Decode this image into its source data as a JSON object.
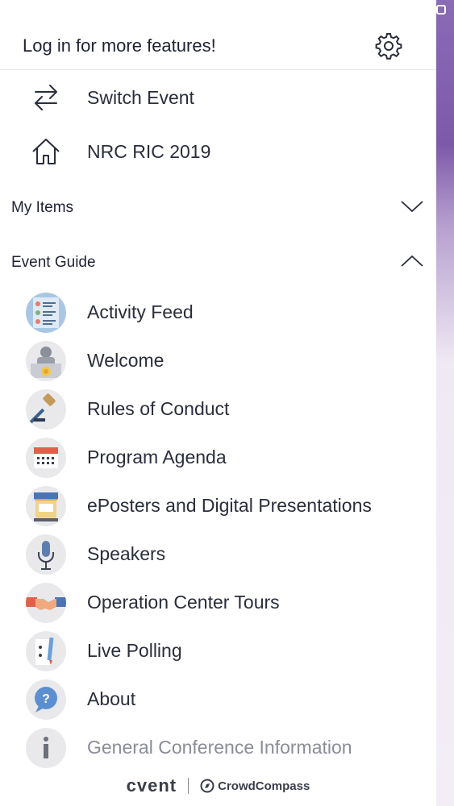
{
  "header": {
    "login_prompt": "Log in for more features!",
    "settings_icon": "gear-icon"
  },
  "top_items": [
    {
      "label": "Switch Event",
      "icon": "swap-arrows-icon"
    },
    {
      "label": "NRC RIC 2019",
      "icon": "home-icon"
    }
  ],
  "sections": {
    "my_items": {
      "label": "My Items",
      "state": "collapsed"
    },
    "event_guide": {
      "label": "Event Guide",
      "state": "expanded"
    }
  },
  "guide_items": [
    {
      "label": "Activity Feed",
      "icon": "activity-feed-icon"
    },
    {
      "label": "Welcome",
      "icon": "welcome-badge-icon"
    },
    {
      "label": "Rules of Conduct",
      "icon": "gavel-icon"
    },
    {
      "label": "Program Agenda",
      "icon": "calendar-icon"
    },
    {
      "label": "ePosters and Digital Presentations",
      "icon": "poster-stand-icon"
    },
    {
      "label": "Speakers",
      "icon": "microphone-icon"
    },
    {
      "label": "Operation Center Tours",
      "icon": "handshake-icon"
    },
    {
      "label": "Live Polling",
      "icon": "polling-pencil-icon"
    },
    {
      "label": "About",
      "icon": "question-bubble-icon"
    },
    {
      "label": "General Conference Information",
      "icon": "info-icon"
    }
  ],
  "footer": {
    "brand_primary": "cvent",
    "brand_secondary": "CrowdCompass"
  },
  "colors": {
    "text": "#1f2235",
    "divider": "#e3e3e8",
    "icon_bg": "#e9e9ec",
    "backdrop": "#7d5aa9"
  }
}
